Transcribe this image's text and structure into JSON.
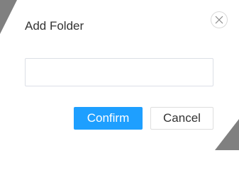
{
  "dialog": {
    "title": "Add Folder",
    "close_icon": "close-icon",
    "input": {
      "value": "",
      "placeholder": ""
    },
    "confirm_label": "Confirm",
    "cancel_label": "Cancel"
  },
  "colors": {
    "primary": "#1e9fff",
    "backdrop": "#808080"
  }
}
